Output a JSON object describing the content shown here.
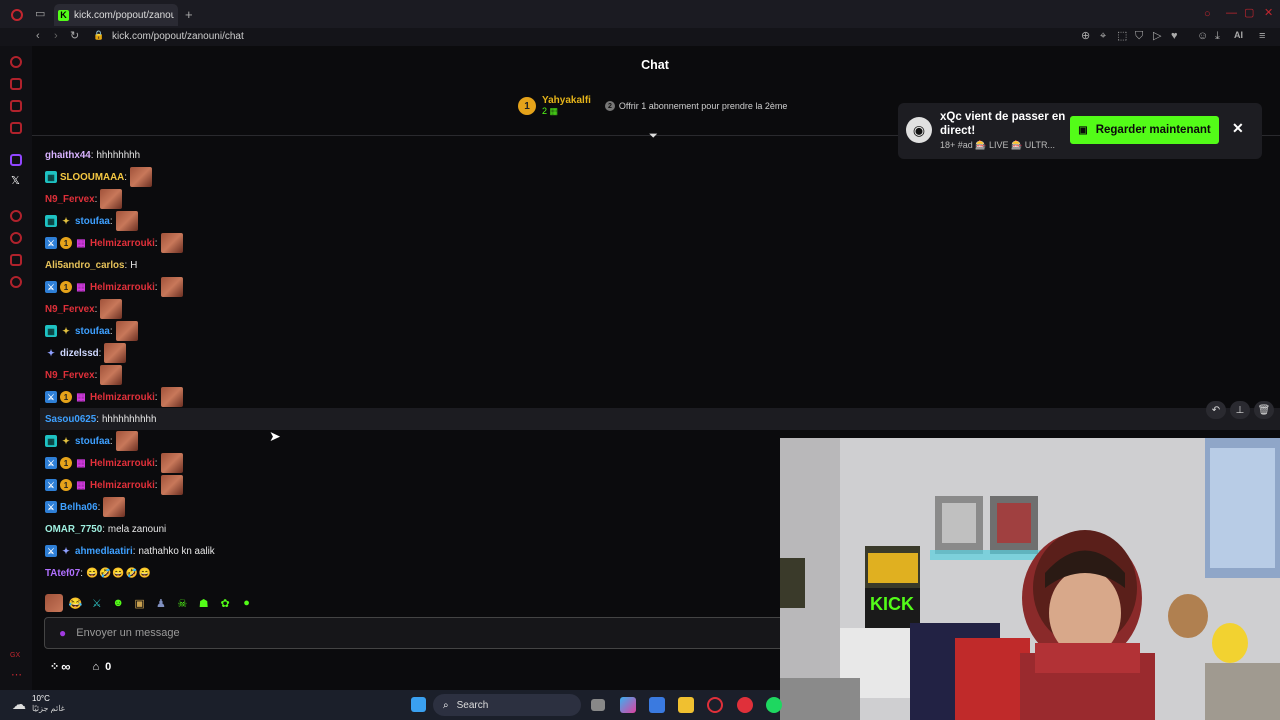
{
  "browser": {
    "tab_title": "kick.com/popout/zanouni/",
    "tab_favicon": "K",
    "url": "kick.com/popout/zanouni/chat",
    "toolbar_ai": "AI"
  },
  "chat": {
    "title": "Chat",
    "pinned": {
      "rank": "1",
      "name": "Yahyakalfi",
      "subs": "2",
      "offer_num": "2",
      "offer_text": "Offrir 1 abonnement pour prendre la 2ème"
    },
    "messages": [
      {
        "user": "ghaithx44",
        "color": "#d9b3ff",
        "badges": [],
        "text": "hhhhhhhh",
        "emote": false,
        "hl": false
      },
      {
        "user": "SLOOUMAAA",
        "color": "#f5c842",
        "badges": [
          "sub"
        ],
        "text": "",
        "emote": true,
        "hl": false
      },
      {
        "user": "N9_Fervex",
        "color": "#e0303a",
        "badges": [],
        "text": "",
        "emote": true,
        "hl": false
      },
      {
        "user": "stoufaa",
        "color": "#3ea0ff",
        "badges": [
          "sub",
          "og"
        ],
        "text": "",
        "emote": true,
        "hl": false
      },
      {
        "user": "Helmizarrouki",
        "color": "#e0303a",
        "badges": [
          "vip",
          "gold",
          "gift"
        ],
        "text": "",
        "emote": true,
        "hl": false
      },
      {
        "user": "Ali5andro_carlos",
        "color": "#e6c25a",
        "badges": [],
        "text": "H",
        "emote": false,
        "hl": false
      },
      {
        "user": "Helmizarrouki",
        "color": "#e0303a",
        "badges": [
          "vip",
          "gold",
          "gift"
        ],
        "text": "",
        "emote": true,
        "hl": false
      },
      {
        "user": "N9_Fervex",
        "color": "#e0303a",
        "badges": [],
        "text": "",
        "emote": true,
        "hl": false
      },
      {
        "user": "stoufaa",
        "color": "#3ea0ff",
        "badges": [
          "sub",
          "og"
        ],
        "text": "",
        "emote": true,
        "hl": false
      },
      {
        "user": "dizelssd",
        "color": "#cfd8ff",
        "badges": [
          "og2"
        ],
        "text": "",
        "emote": true,
        "hl": false
      },
      {
        "user": "N9_Fervex",
        "color": "#e0303a",
        "badges": [],
        "text": "",
        "emote": true,
        "hl": false
      },
      {
        "user": "Helmizarrouki",
        "color": "#e0303a",
        "badges": [
          "vip",
          "gold",
          "gift"
        ],
        "text": "",
        "emote": true,
        "hl": false
      },
      {
        "user": "Sasou0625",
        "color": "#3ea0ff",
        "badges": [],
        "text": "hhhhhhhhhh",
        "emote": false,
        "hl": true
      },
      {
        "user": "stoufaa",
        "color": "#3ea0ff",
        "badges": [
          "sub",
          "og"
        ],
        "text": "",
        "emote": true,
        "hl": false
      },
      {
        "user": "Helmizarrouki",
        "color": "#e0303a",
        "badges": [
          "vip",
          "gold",
          "gift"
        ],
        "text": "",
        "emote": true,
        "hl": false
      },
      {
        "user": "Helmizarrouki",
        "color": "#e0303a",
        "badges": [
          "vip",
          "gold",
          "gift"
        ],
        "text": "",
        "emote": true,
        "hl": false
      },
      {
        "user": "Belha06",
        "color": "#3ea0ff",
        "badges": [
          "vip"
        ],
        "text": "",
        "emote": true,
        "hl": false
      },
      {
        "user": "OMAR_7750",
        "color": "#9ff0e0",
        "badges": [],
        "text": "mela zanouni",
        "emote": false,
        "hl": false
      },
      {
        "user": "ahmedlaatiri",
        "color": "#3ea0ff",
        "badges": [
          "vip",
          "og2"
        ],
        "text": "nathahko kn aalik",
        "emote": false,
        "hl": false
      },
      {
        "user": "TAtef07",
        "color": "#b070ff",
        "badges": [],
        "text": "",
        "emote": false,
        "emoji": "😄🤣😄🤣😄",
        "hl": false
      }
    ],
    "input_placeholder": "Envoyer un message",
    "footer_infinity": "∞",
    "footer_count": "0"
  },
  "notification": {
    "title": "xQc vient de passer en direct!",
    "subtitle": "18+ #ad 🎰 LIVE 🎰 ULTR...",
    "button_label": "Regarder maintenant",
    "close": "✕"
  },
  "taskbar": {
    "temp": "10°C",
    "weather_text": "غائم جزئيًا",
    "search_label": "Search"
  },
  "colors": {
    "kick_green": "#53fc18",
    "background": "#0b0b0d"
  }
}
